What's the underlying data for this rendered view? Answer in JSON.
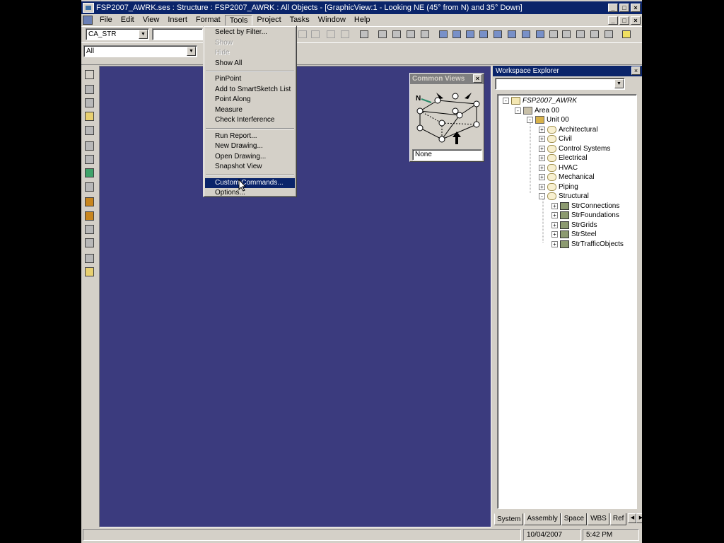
{
  "window": {
    "title": "FSP2007_AWRK.ses : Structure : FSP2007_AWRK : All Objects - [GraphicView:1 - Looking NE (45° from N) and 35° Down]",
    "minimize": "_",
    "maximize": "□",
    "close": "×"
  },
  "menubar": {
    "items": [
      "File",
      "Edit",
      "View",
      "Insert",
      "Format",
      "Tools",
      "Project",
      "Tasks",
      "Window",
      "Help"
    ],
    "active": "Tools"
  },
  "toolbar": {
    "permission_group": "CA_STR",
    "filter": "All"
  },
  "tools_menu": {
    "groups": [
      [
        {
          "label": "Select by Filter...",
          "enabled": true
        },
        {
          "label": "Show",
          "enabled": false
        },
        {
          "label": "Hide",
          "enabled": false
        },
        {
          "label": "Show All",
          "enabled": true
        }
      ],
      [
        {
          "label": "PinPoint",
          "enabled": true
        },
        {
          "label": "Add to SmartSketch List",
          "enabled": true
        },
        {
          "label": "Point Along",
          "enabled": true
        },
        {
          "label": "Measure",
          "enabled": true
        },
        {
          "label": "Check Interference",
          "enabled": true
        }
      ],
      [
        {
          "label": "Run Report...",
          "enabled": true
        },
        {
          "label": "New Drawing...",
          "enabled": true
        },
        {
          "label": "Open Drawing...",
          "enabled": true
        },
        {
          "label": "Snapshot View",
          "enabled": true
        }
      ],
      [
        {
          "label": "Custom Commands...",
          "enabled": true,
          "highlighted": true
        },
        {
          "label": "Options...",
          "enabled": true
        }
      ]
    ]
  },
  "common_views": {
    "title": "Common Views",
    "north_label": "N",
    "value": "None",
    "close": "×"
  },
  "workspace_explorer": {
    "title": "Workspace Explorer",
    "close": "×",
    "combo_value": "",
    "tree": {
      "root": "FSP2007_AWRK",
      "area": "Area 00",
      "unit": "Unit 00",
      "systems": [
        "Architectural",
        "Civil",
        "Control Systems",
        "Electrical",
        "HVAC",
        "Mechanical",
        "Piping",
        "Structural"
      ],
      "structural_children": [
        "StrConnections",
        "StrFoundations",
        "StrGrids",
        "StrSteel",
        "StrTrafficObjects"
      ]
    },
    "tabs": [
      "System",
      "Assembly",
      "Space",
      "WBS",
      "Ref"
    ],
    "active_tab": "System"
  },
  "status": {
    "message": "",
    "date": "10/04/2007",
    "time": "5:42 PM"
  },
  "colors": {
    "graphic_background": "#3b3b7e",
    "title_bar": "#0a246a",
    "menu_highlight": "#0a246a"
  }
}
